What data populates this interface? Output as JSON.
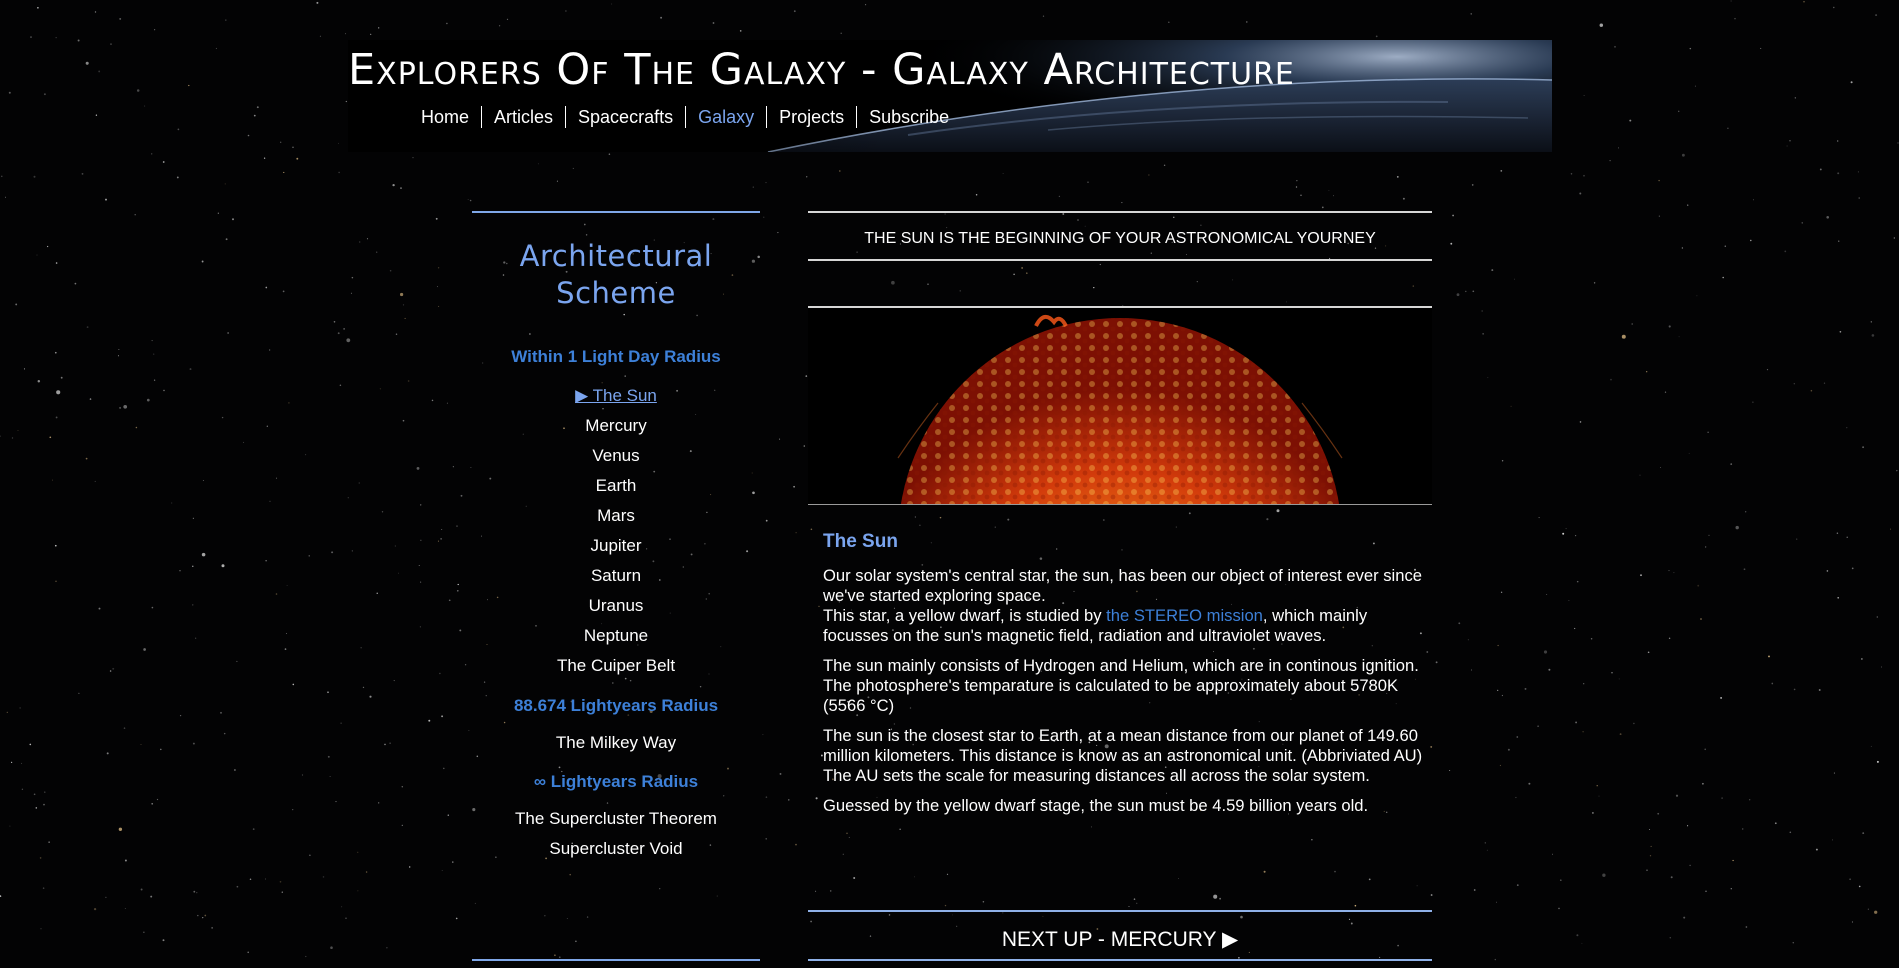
{
  "header": {
    "title": "Explorers Of The Galaxy - Galaxy Architecture",
    "nav": [
      {
        "label": "Home",
        "active": false
      },
      {
        "label": "Articles",
        "active": false
      },
      {
        "label": "Spacecrafts",
        "active": false
      },
      {
        "label": "Galaxy",
        "active": true
      },
      {
        "label": "Projects",
        "active": false
      },
      {
        "label": "Subscribe",
        "active": false
      }
    ]
  },
  "sidebar": {
    "heading_line1": "Architectural",
    "heading_line2": "Scheme",
    "sections": [
      {
        "title": "Within 1 Light Day Radius",
        "items": [
          {
            "label": "▶ The Sun",
            "active": true
          },
          {
            "label": "Mercury",
            "active": false
          },
          {
            "label": "Venus",
            "active": false
          },
          {
            "label": "Earth",
            "active": false
          },
          {
            "label": "Mars",
            "active": false
          },
          {
            "label": "Jupiter",
            "active": false
          },
          {
            "label": "Saturn",
            "active": false
          },
          {
            "label": "Uranus",
            "active": false
          },
          {
            "label": "Neptune",
            "active": false
          },
          {
            "label": "The Cuiper Belt",
            "active": false
          }
        ]
      },
      {
        "title": "88.674 Lightyears Radius",
        "items": [
          {
            "label": "The Milkey Way",
            "active": false
          }
        ]
      },
      {
        "title": "∞ Lightyears Radius",
        "items": [
          {
            "label": "The Supercluster Theorem",
            "active": false
          },
          {
            "label": "Supercluster Void",
            "active": false
          }
        ]
      }
    ]
  },
  "main": {
    "tagline": "THE SUN IS THE BEGINNING OF YOUR ASTRONOMICAL YOURNEY",
    "article": {
      "title": "The Sun",
      "p1_line1": "Our solar system's central star, the sun, has been our object of interest ever since we've started exploring space.",
      "p1_line2_before": "This star, a yellow dwarf, is studied by ",
      "p1_link": "the STEREO mission",
      "p1_line2_after": ", which mainly focusses on the sun's magnetic field, radiation and ultraviolet waves.",
      "p2": "The sun mainly consists of Hydrogen and Helium, which are in continous ignition. The photosphere's temparature is calculated to be approximately about 5780K (5566 °C)",
      "p3": "The sun is the closest star to Earth, at a mean distance from our planet of 149.60 million kilometers. This distance is know as an astronomical unit. (Abbriviated AU) The AU sets the scale for measuring distances all across the solar system.",
      "p4": "Guessed by the yellow dwarf stage, the sun must be 4.59 billion years old."
    },
    "next_up": "NEXT UP - MERCURY ▶"
  },
  "colors": {
    "accent": "#7ba5ef",
    "section_blue": "#3d80d8",
    "background": "#030304",
    "text": "#ffffff"
  }
}
